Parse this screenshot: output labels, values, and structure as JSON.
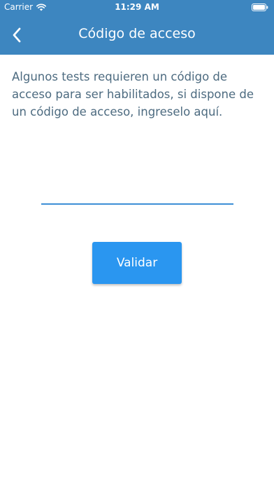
{
  "status_bar": {
    "carrier": "Carrier",
    "time": "11:29 AM",
    "wifi_icon": "wifi-icon",
    "battery_icon": "battery-icon"
  },
  "nav": {
    "title": "Código de acceso",
    "back_icon": "chevron-left-icon"
  },
  "content": {
    "description": "Algunos tests requieren un código de acceso para ser habilitados, si dispone de un código de acceso, ingreselo aquí.",
    "code_input_value": "",
    "code_input_placeholder": "",
    "validate_label": "Validar"
  },
  "colors": {
    "header_bg": "#3d86c0",
    "text": "#4d6b80",
    "input_underline": "#3d8fd6",
    "button_bg": "#2a96f0"
  }
}
